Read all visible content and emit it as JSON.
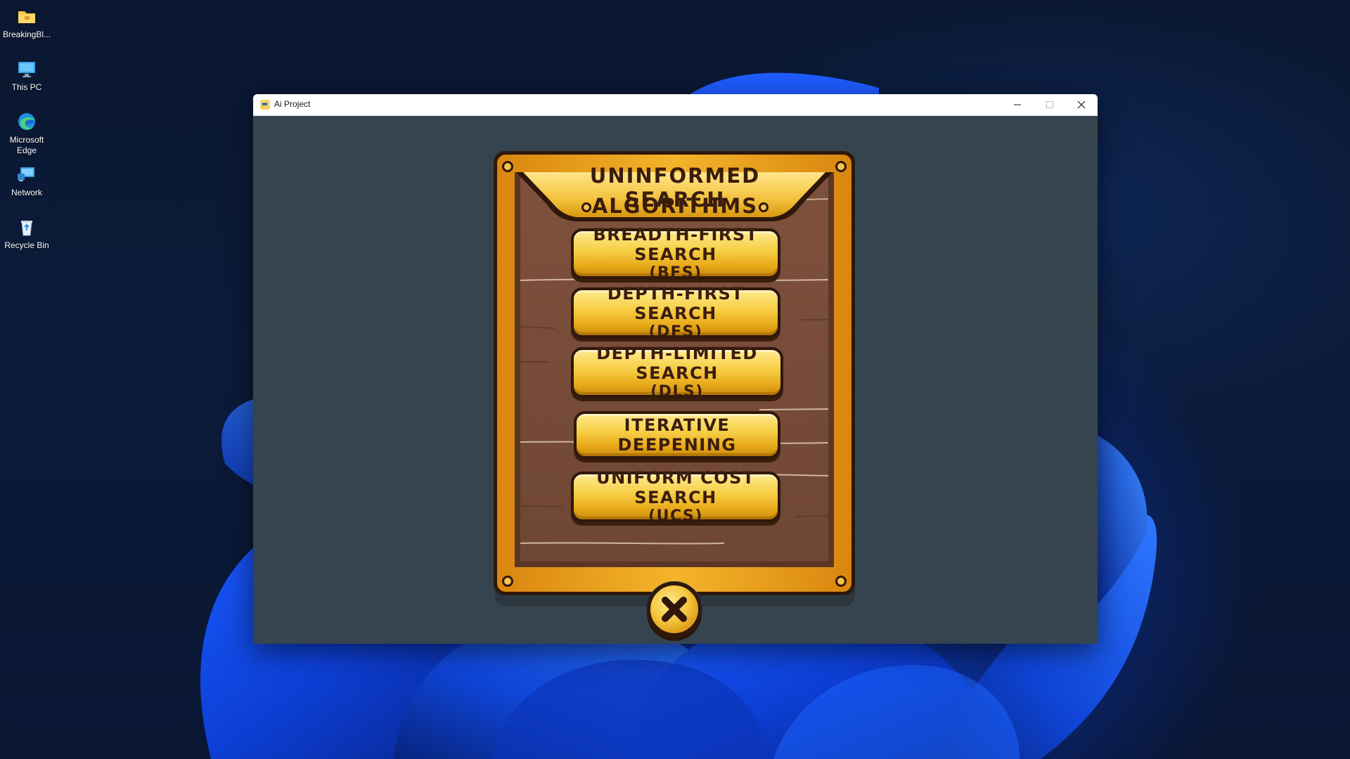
{
  "desktop": {
    "icons": [
      {
        "label": "BreakingBl...",
        "icon": "folder-icon"
      },
      {
        "label": "This PC",
        "icon": "monitor-icon"
      },
      {
        "label": "Microsoft Edge",
        "icon": "edge-icon"
      },
      {
        "label": "Network",
        "icon": "network-icon"
      },
      {
        "label": "Recycle Bin",
        "icon": "recycle-bin-icon"
      }
    ]
  },
  "window": {
    "title": "Ai Project",
    "controls": [
      "minimize-icon",
      "maximize-icon",
      "close-icon"
    ]
  },
  "panel": {
    "title_line1": "UNINFORMED SEARCH",
    "title_line2": "ALGORITHMS",
    "buttons": [
      {
        "line1": "BREADTH-FIRST SEARCH",
        "line2": "(BFS)"
      },
      {
        "line1": "DEPTH-FIRST SEARCH",
        "line2": "(DFS)"
      },
      {
        "line1": "DEPTH-LIMITED SEARCH",
        "line2": "(DLS)"
      },
      {
        "line1": "ITERATIVE DEEPENING",
        "line2": ""
      },
      {
        "line1": "UNIFORM COST SEARCH",
        "line2": "(UCS)"
      }
    ],
    "close_icon": "x-icon"
  },
  "colors": {
    "window_bg": "#36444f",
    "frame_gold": "#e9a21a",
    "wood": "#7a4e3a",
    "button_gold": "#f7cf47",
    "text_dark": "#3b1d0d"
  }
}
